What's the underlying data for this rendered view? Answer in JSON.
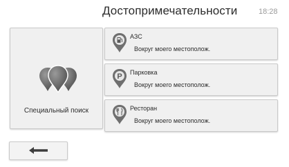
{
  "header": {
    "title": "Достопримечательности",
    "time": "18:28"
  },
  "special_search": {
    "label": "Специальный поиск",
    "icon": "poi-cluster-icon"
  },
  "poi_items": [
    {
      "name": "АЗС",
      "subtitle": "Вокруг моего местополож.",
      "icon": "fuel-pump-pin-icon"
    },
    {
      "name": "Парковка",
      "subtitle": "Вокруг моего местополож.",
      "icon": "parking-pin-icon"
    },
    {
      "name": "Ресторан",
      "subtitle": "Вокруг моего местополож.",
      "icon": "restaurant-pin-icon"
    }
  ],
  "footer": {
    "back_icon": "arrow-left-icon"
  },
  "colors": {
    "panel_bg": "#f0f0f0",
    "border": "#c9c9c9",
    "icon_gray": "#6f6f6f",
    "text": "#2b2b2b"
  }
}
